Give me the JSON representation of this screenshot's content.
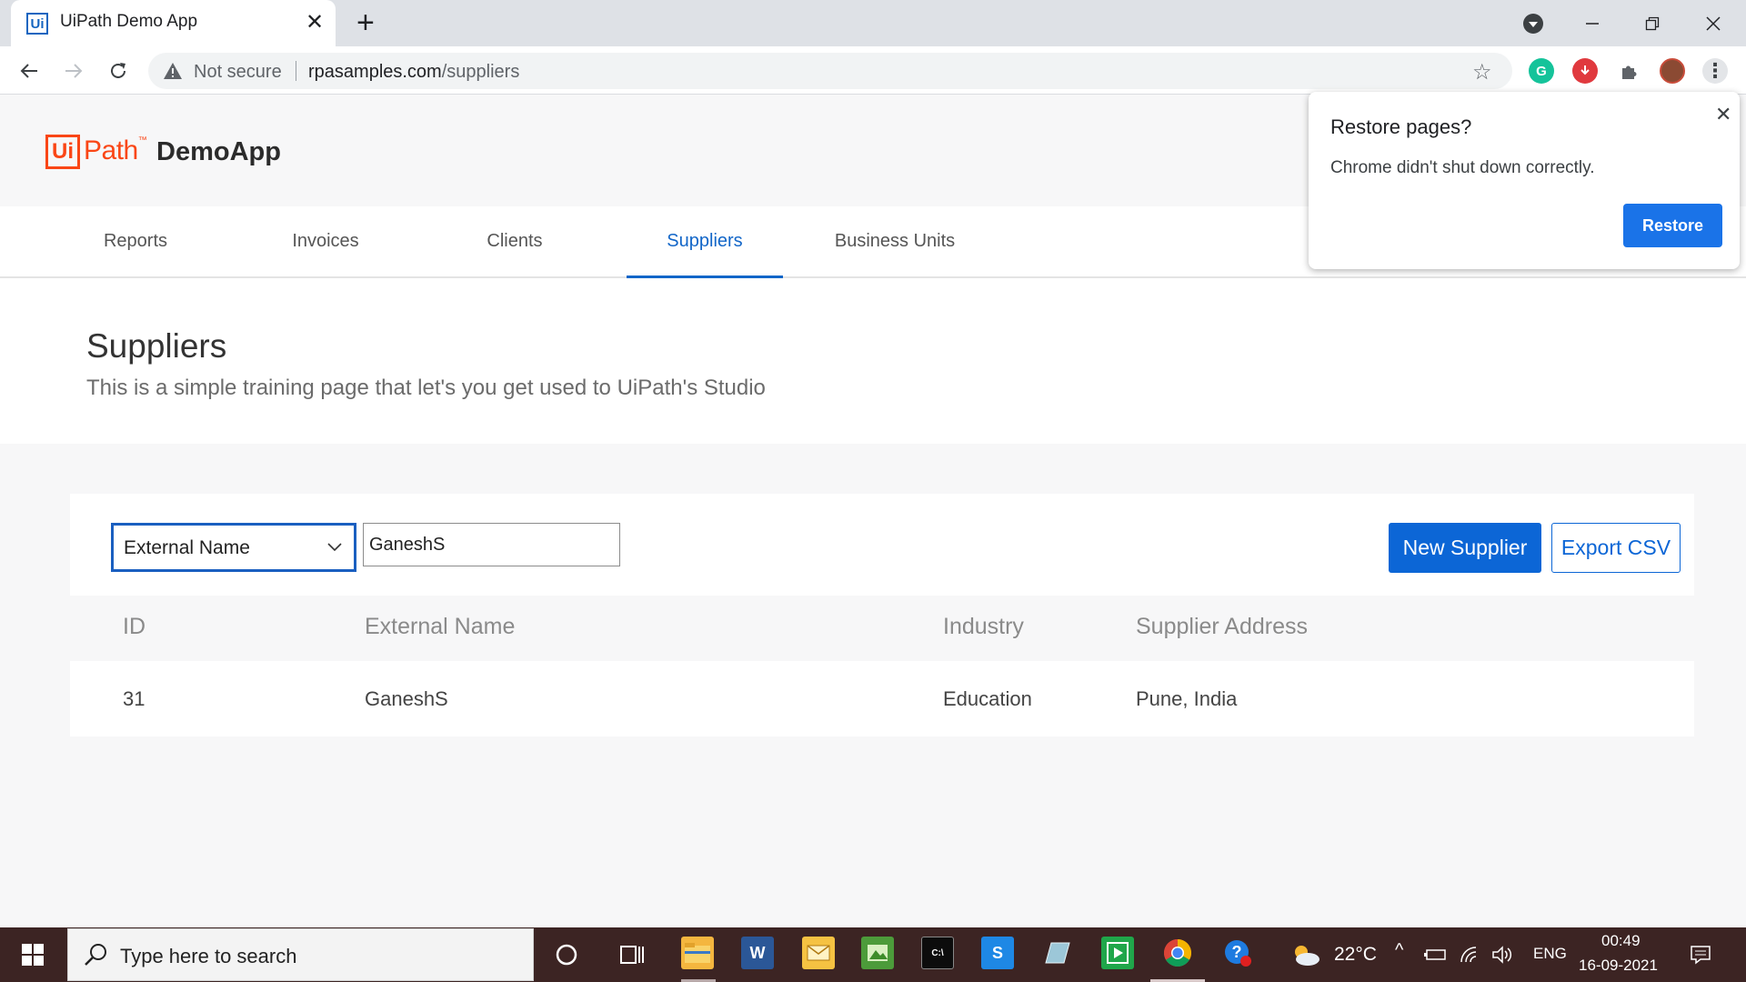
{
  "browser": {
    "tab_title": "UiPath Demo App",
    "tab_favicon": "Ui",
    "security_label": "Not secure",
    "url_host": "rpasamples.com",
    "url_path": "/suppliers"
  },
  "app": {
    "logo_mark": "Ui",
    "logo_text": "Path",
    "logo_tm": "™",
    "app_name": "DemoApp",
    "nav": [
      {
        "label": "Reports"
      },
      {
        "label": "Invoices"
      },
      {
        "label": "Clients"
      },
      {
        "label": "Suppliers",
        "active": true
      },
      {
        "label": "Business Units"
      }
    ],
    "page_title": "Suppliers",
    "page_subtitle": "This is a simple training page that let's you get used to UiPath's Studio"
  },
  "filter": {
    "field_select": "External Name",
    "search_value": "GaneshS",
    "new_button": "New Supplier",
    "export_button": "Export CSV"
  },
  "table": {
    "columns": [
      "ID",
      "External Name",
      "Industry",
      "Supplier Address"
    ],
    "rows": [
      [
        "31",
        "GaneshS",
        "Education",
        "Pune, India"
      ]
    ]
  },
  "popup": {
    "title": "Restore pages?",
    "message": "Chrome didn't shut down correctly.",
    "button": "Restore"
  },
  "taskbar": {
    "search_placeholder": "Type here to search",
    "temperature": "22°C",
    "language": "ENG",
    "time": "00:49",
    "date": "16-09-2021"
  },
  "colors": {
    "accent": "#1266c8",
    "brand": "#fa4616",
    "chrome_button": "#1a73e8"
  }
}
